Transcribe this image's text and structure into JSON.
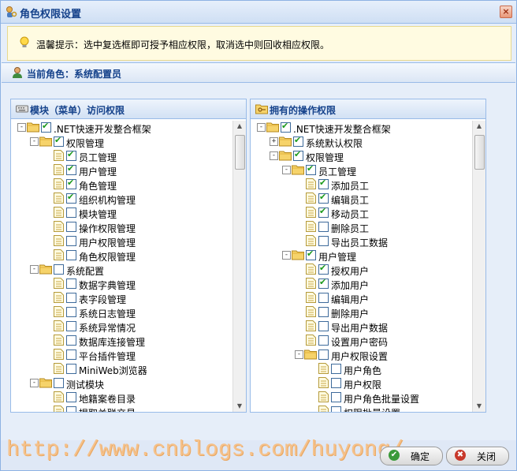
{
  "window": {
    "title": "角色权限设置"
  },
  "tip": {
    "text": "温馨提示：选中复选框即可授予相应权限，取消选中则回收相应权限。"
  },
  "role": {
    "label": "当前角色：系统配置员"
  },
  "left_panel": {
    "title": "模块（菜单）访问权限",
    "items": [
      {
        "label": ".NET快速开发整合框架",
        "level": 0,
        "type": "folder",
        "expander": "-",
        "checked": true
      },
      {
        "label": "权限管理",
        "level": 1,
        "type": "folder",
        "expander": "-",
        "checked": true
      },
      {
        "label": "员工管理",
        "level": 2,
        "type": "doc",
        "checked": true
      },
      {
        "label": "用户管理",
        "level": 2,
        "type": "doc",
        "checked": true
      },
      {
        "label": "角色管理",
        "level": 2,
        "type": "doc",
        "checked": true
      },
      {
        "label": "组织机构管理",
        "level": 2,
        "type": "doc",
        "checked": true
      },
      {
        "label": "模块管理",
        "level": 2,
        "type": "doc",
        "checked": false
      },
      {
        "label": "操作权限管理",
        "level": 2,
        "type": "doc",
        "checked": false
      },
      {
        "label": "用户权限管理",
        "level": 2,
        "type": "doc",
        "checked": false
      },
      {
        "label": "角色权限管理",
        "level": 2,
        "type": "doc",
        "checked": false
      },
      {
        "label": "系统配置",
        "level": 1,
        "type": "folder",
        "expander": "-",
        "checked": false
      },
      {
        "label": "数据字典管理",
        "level": 2,
        "type": "doc",
        "checked": false
      },
      {
        "label": "表字段管理",
        "level": 2,
        "type": "doc",
        "checked": false
      },
      {
        "label": "系统日志管理",
        "level": 2,
        "type": "doc",
        "checked": false
      },
      {
        "label": "系统异常情况",
        "level": 2,
        "type": "doc",
        "checked": false
      },
      {
        "label": "数据库连接管理",
        "level": 2,
        "type": "doc",
        "checked": false
      },
      {
        "label": "平台插件管理",
        "level": 2,
        "type": "doc",
        "checked": false
      },
      {
        "label": "MiniWeb浏览器",
        "level": 2,
        "type": "doc",
        "checked": false
      },
      {
        "label": "测试模块",
        "level": 1,
        "type": "folder",
        "expander": "-",
        "checked": false
      },
      {
        "label": "地籍案卷目录",
        "level": 2,
        "type": "doc",
        "checked": false
      },
      {
        "label": "提取关联交易",
        "level": 2,
        "type": "doc",
        "checked": false
      }
    ]
  },
  "right_panel": {
    "title": "拥有的操作权限",
    "items": [
      {
        "label": ".NET快速开发整合框架",
        "level": 0,
        "type": "folder",
        "expander": "-",
        "checked": true
      },
      {
        "label": "系统默认权限",
        "level": 1,
        "type": "folder",
        "expander": "+",
        "checked": true
      },
      {
        "label": "权限管理",
        "level": 1,
        "type": "folder",
        "expander": "-",
        "checked": true
      },
      {
        "label": "员工管理",
        "level": 2,
        "type": "folder",
        "expander": "-",
        "checked": true
      },
      {
        "label": "添加员工",
        "level": 3,
        "type": "doc",
        "checked": true
      },
      {
        "label": "编辑员工",
        "level": 3,
        "type": "doc",
        "checked": true
      },
      {
        "label": "移动员工",
        "level": 3,
        "type": "doc",
        "checked": true
      },
      {
        "label": "删除员工",
        "level": 3,
        "type": "doc",
        "checked": false
      },
      {
        "label": "导出员工数据",
        "level": 3,
        "type": "doc",
        "checked": false
      },
      {
        "label": "用户管理",
        "level": 2,
        "type": "folder",
        "expander": "-",
        "checked": true
      },
      {
        "label": "授权用户",
        "level": 3,
        "type": "doc",
        "checked": true
      },
      {
        "label": "添加用户",
        "level": 3,
        "type": "doc",
        "checked": true
      },
      {
        "label": "编辑用户",
        "level": 3,
        "type": "doc",
        "checked": false
      },
      {
        "label": "删除用户",
        "level": 3,
        "type": "doc",
        "checked": false
      },
      {
        "label": "导出用户数据",
        "level": 3,
        "type": "doc",
        "checked": false
      },
      {
        "label": "设置用户密码",
        "level": 3,
        "type": "doc",
        "checked": false
      },
      {
        "label": "用户权限设置",
        "level": 3,
        "type": "folder",
        "expander": "-",
        "checked": false
      },
      {
        "label": "用户角色",
        "level": 4,
        "type": "doc",
        "checked": false
      },
      {
        "label": "用户权限",
        "level": 4,
        "type": "doc",
        "checked": false
      },
      {
        "label": "用户角色批量设置",
        "level": 4,
        "type": "doc",
        "checked": false
      },
      {
        "label": "权限批量设置",
        "level": 4,
        "type": "doc",
        "checked": false
      }
    ]
  },
  "watermark": "http://www.cnblogs.com/huyong/",
  "buttons": {
    "ok": "确定",
    "close": "关闭"
  },
  "icons": {
    "title": "role-key-icon",
    "tip": "lightbulb-icon",
    "role": "user-icon",
    "left_header": "keyboard-icon",
    "right_header": "key-folder-icon",
    "ok": "check-circle-icon",
    "close": "x-circle-icon"
  },
  "colors": {
    "header_text": "#15428b",
    "border": "#99bbe8",
    "check": "#1c9a1c",
    "watermark": "#f5c18a"
  }
}
